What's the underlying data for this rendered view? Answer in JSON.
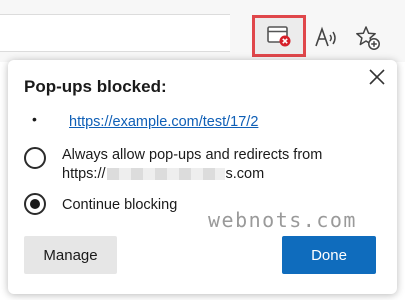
{
  "toolbar": {
    "popup_blocked_icon": "popup-blocked-icon",
    "read_aloud_icon": "read-aloud-icon",
    "add_favorite_icon": "star-plus-icon",
    "highlight_color": "#e0474b"
  },
  "flyout": {
    "title": "Pop-ups blocked:",
    "bullet": "•",
    "blocked_url": "https://example.com/test/17/2",
    "options": {
      "allow_line1": "Always allow pop-ups and redirects from",
      "allow_prefix": "https://",
      "allow_suffix": "s.com",
      "block_label": "Continue blocking",
      "selected": "Continue blocking"
    },
    "manage_label": "Manage",
    "done_label": "Done",
    "close_icon": "close-icon"
  },
  "watermark": "webnots.com",
  "colors": {
    "accent": "#0f6cbd",
    "link": "#0f5fb6"
  }
}
